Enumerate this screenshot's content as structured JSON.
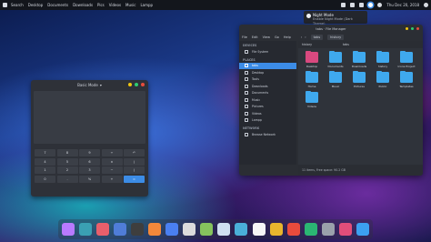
{
  "topbar": {
    "menu": [
      "Search",
      "Desktop",
      "Documents",
      "Downloads",
      "Pics",
      "Videos",
      "Music",
      "Lampp"
    ],
    "clock": "Thu Dec 20, 2018",
    "tray_icons": [
      "volume-icon",
      "battery-icon",
      "network-icon",
      "night-mode-icon",
      "user-icon",
      "power-icon"
    ]
  },
  "tooltip": {
    "title": "Night Mode",
    "subtitle": "Enable Night Mode (Dark Theme)"
  },
  "calculator": {
    "mode": "Basic Mode",
    "keys": [
      "7",
      "8",
      "9",
      "÷",
      "↶",
      "4",
      "5",
      "6",
      "×",
      "(",
      "1",
      "2",
      "3",
      "−",
      ")",
      "0",
      ".",
      "%",
      "+",
      "="
    ]
  },
  "file_manager": {
    "title": "tabs · File Manager",
    "menu": [
      "File",
      "Edit",
      "View",
      "Go",
      "Help"
    ],
    "crumbs": [
      "tabs",
      "history"
    ],
    "sections": {
      "devices": "DEVICES",
      "places": "PLACES",
      "network": "NETWORK"
    },
    "devices": [
      "File System"
    ],
    "places": [
      "tabs",
      "Desktop",
      "Tools",
      "Downloads",
      "Documents",
      "Music",
      "Pictures",
      "Videos",
      "Lampp"
    ],
    "network": [
      "Browse Network"
    ],
    "path_left": "history",
    "path_right": "tabs",
    "items": [
      {
        "label": "Desktop",
        "color": "pink"
      },
      {
        "label": "Documents",
        "color": "blue"
      },
      {
        "label": "Downloads",
        "color": "blue"
      },
      {
        "label": "history",
        "color": "blue"
      },
      {
        "label": "Icons Project",
        "color": "blue"
      },
      {
        "label": "Home",
        "color": "blue"
      },
      {
        "label": "Music",
        "color": "blue"
      },
      {
        "label": "Pictures",
        "color": "blue"
      },
      {
        "label": "Public",
        "color": "blue"
      },
      {
        "label": "Templates",
        "color": "blue"
      },
      {
        "label": "Videos",
        "color": "blue"
      }
    ],
    "status": "11 items, Free space: 90.2 GB"
  },
  "dock": {
    "apps": [
      {
        "name": "finder-icon",
        "color": "#b87aff"
      },
      {
        "name": "terminal-icon",
        "color": "#3aa0b3"
      },
      {
        "name": "editor-icon",
        "color": "#e75f6b"
      },
      {
        "name": "files-icon",
        "color": "#4f7dd8"
      },
      {
        "name": "books-icon",
        "color": "#3e3e3e"
      },
      {
        "name": "firefox-icon",
        "color": "#f3883a"
      },
      {
        "name": "chromium-icon",
        "color": "#4a7ff1"
      },
      {
        "name": "search-icon",
        "color": "#dcdcdc"
      },
      {
        "name": "android-icon",
        "color": "#86c45d"
      },
      {
        "name": "calendar-icon",
        "color": "#cfe0f0"
      },
      {
        "name": "weather-icon",
        "color": "#4ab0d8"
      },
      {
        "name": "rocket-icon",
        "color": "#f6f6f6"
      },
      {
        "name": "maps-icon",
        "color": "#e8b52d"
      },
      {
        "name": "video-icon",
        "color": "#e84b3c"
      },
      {
        "name": "music-icon",
        "color": "#2bb673"
      },
      {
        "name": "gear-icon",
        "color": "#9aa1ab"
      },
      {
        "name": "store-icon",
        "color": "#e24e7a"
      },
      {
        "name": "mail-icon",
        "color": "#3ca0f0"
      }
    ]
  }
}
